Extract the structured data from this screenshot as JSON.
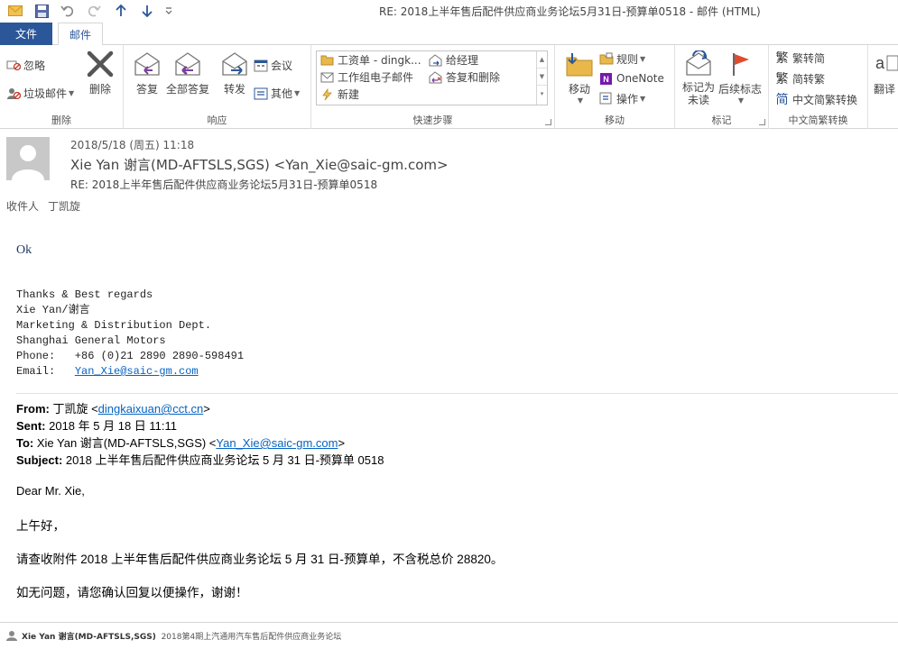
{
  "window": {
    "title": "RE: 2018上半年售后配件供应商业务论坛5月31日-预算单0518 - 邮件 (HTML)"
  },
  "tabs": {
    "file": "文件",
    "mail": "邮件"
  },
  "ribbon": {
    "delete_group": {
      "label": "删除",
      "ignore": "忽略",
      "junk": "垃圾邮件",
      "delete": "删除"
    },
    "respond_group": {
      "label": "响应",
      "reply": "答复",
      "reply_all": "全部答复",
      "forward": "转发",
      "meeting": "会议",
      "more": "其他"
    },
    "quicksteps_group": {
      "label": "快速步骤",
      "items": [
        "工资单 - dingk...",
        "给经理",
        "工作组电子邮件",
        "答复和删除",
        "新建"
      ]
    },
    "move_group": {
      "label": "移动",
      "move": "移动",
      "rules": "规则",
      "onenote": "OneNote",
      "actions": "操作"
    },
    "tags_group": {
      "label": "标记",
      "mark_unread": "标记为未读",
      "follow_up": "后续标志"
    },
    "convert_group": {
      "label": "中文简繁转换",
      "to_simplified": "繁转简",
      "to_traditional": "简转繁",
      "convert": "中文简繁转换"
    },
    "translate_label": "翻译"
  },
  "header": {
    "date": "2018/5/18 (周五) 11:18",
    "sender": "Xie Yan 谢言(MD-AFTSLS,SGS) <Yan_Xie@saic-gm.com>",
    "subject": "RE: 2018上半年售后配件供应商业务论坛5月31日-预算单0518",
    "to_label": "收件人",
    "to_value": "丁凯旋"
  },
  "body": {
    "reply": "Ok",
    "signature": {
      "regards": "Thanks & Best regards",
      "name": "Xie Yan/谢言",
      "dept": "Marketing & Distribution Dept.",
      "company": "Shanghai General Motors",
      "phone": "Phone:   +86 (0)21 2890 2890-598491",
      "email_label": "Email:   ",
      "email": "Yan_Xie@saic-gm.com"
    },
    "quoted": {
      "from_label": "From:",
      "from_name": " 丁凯旋 <",
      "from_email": "dingkaixuan@cct.cn",
      "from_close": ">",
      "sent_label": "Sent:",
      "sent_value": " 2018 年 5 月 18 日 11:11",
      "to_label": "To:",
      "to_name": " Xie Yan 谢言(MD-AFTSLS,SGS) <",
      "to_email": "Yan_Xie@saic-gm.com",
      "to_close": ">",
      "subject_label": "Subject:",
      "subject_value": " 2018 上半年售后配件供应商业务论坛 5 月 31 日-预算单 0518"
    },
    "greeting": "Dear Mr. Xie,",
    "line1": "上午好，",
    "line2": "请查收附件 2018 上半年售后配件供应商业务论坛 5 月 31 日-预算单，不含税总价 28820。",
    "line3": "如无问题，请您确认回复以便操作，谢谢！"
  },
  "footer": {
    "name": "Xie Yan 谢言(MD-AFTSLS,SGS)",
    "text": "2018第4期上汽通用汽车售后配件供应商业务论坛"
  }
}
